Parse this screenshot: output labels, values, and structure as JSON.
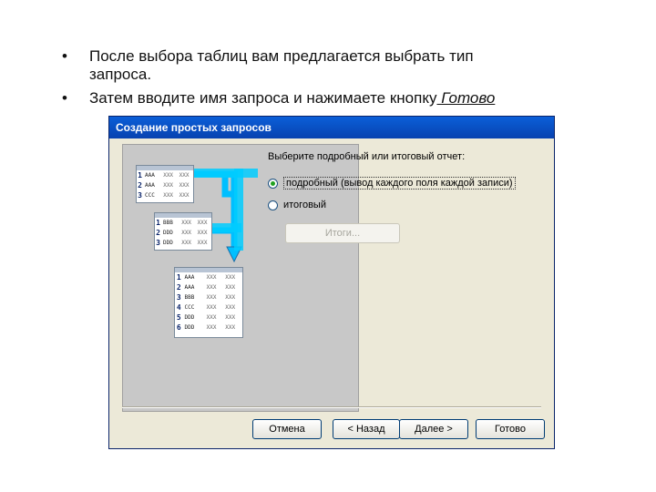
{
  "bullets": [
    {
      "text_line1": "После выбора таблиц вам предлагается выбрать тип",
      "text_line2": "запроса."
    },
    {
      "text_before": "Затем вводите имя запроса и нажимаете кнопку",
      "text_underlined": " Готово"
    }
  ],
  "bullet_symbol": "•",
  "dialog": {
    "title": "Создание простых запросов",
    "prompt": "Выберите подробный или итоговый отчет:",
    "options": [
      {
        "label": "подробный (вывод каждого поля каждой записи)",
        "selected": true
      },
      {
        "label": "итоговый",
        "selected": false
      }
    ],
    "totals_button": "Итоги...",
    "buttons": {
      "cancel": "Отмена",
      "back": "< Назад",
      "next": "Далее >",
      "finish": "Готово"
    },
    "illustration": {
      "table1": [
        [
          "1",
          "AAA",
          "XXX",
          "XXX"
        ],
        [
          "2",
          "AAA",
          "XXX",
          "XXX"
        ],
        [
          "3",
          "CCC",
          "XXX",
          "XXX"
        ]
      ],
      "table2": [
        [
          "1",
          "BBB",
          "XXX",
          "XXX"
        ],
        [
          "2",
          "DDD",
          "XXX",
          "XXX"
        ],
        [
          "3",
          "DDD",
          "XXX",
          "XXX"
        ]
      ],
      "table3": [
        [
          "1",
          "AAA",
          "XXX",
          "XXX"
        ],
        [
          "2",
          "AAA",
          "XXX",
          "XXX"
        ],
        [
          "3",
          "BBB",
          "XXX",
          "XXX"
        ],
        [
          "4",
          "CCC",
          "XXX",
          "XXX"
        ],
        [
          "5",
          "DDD",
          "XXX",
          "XXX"
        ],
        [
          "6",
          "DDD",
          "XXX",
          "XXX"
        ]
      ]
    }
  },
  "colors": {
    "titlebar": "#0A5FD8",
    "arrow": "#00BFFF",
    "radio_selected": "#21A121",
    "dialog_bg": "#ECE9D8"
  }
}
